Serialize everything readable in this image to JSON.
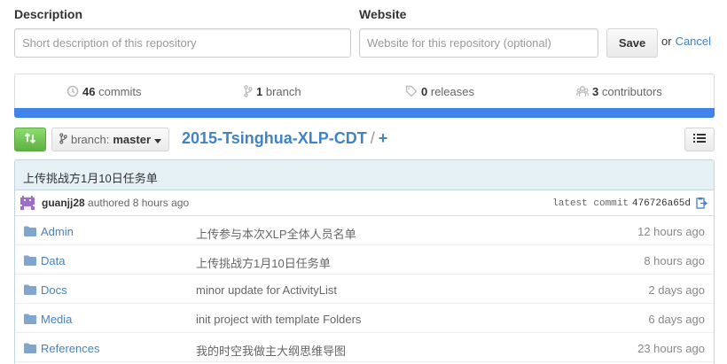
{
  "form": {
    "description_label": "Description",
    "description_placeholder": "Short description of this repository",
    "website_label": "Website",
    "website_placeholder": "Website for this repository (optional)",
    "save_label": "Save",
    "or_text": "or",
    "cancel_label": "Cancel"
  },
  "summary": {
    "commits_count": "46",
    "commits_label": "commits",
    "branch_count": "1",
    "branch_label": "branch",
    "releases_count": "0",
    "releases_label": "releases",
    "contributors_count": "3",
    "contributors_label": "contributors"
  },
  "language_bar": {
    "color": "#4183e8",
    "fraction": 1.0
  },
  "toolbar": {
    "branch_prefix": "branch:",
    "branch_name": "master",
    "repo_name": "2015-Tsinghua-XLP-CDT",
    "separator": "/",
    "plus": "+"
  },
  "commit": {
    "message": "上传挑战方1月10日任务单",
    "author": "guanjj28",
    "authored_text": "authored 8 hours ago",
    "latest_label": "latest commit",
    "sha": "476726a65d"
  },
  "files": [
    {
      "name": "Admin",
      "message": "上传参与本次XLP全体人员名单",
      "age": "12 hours ago"
    },
    {
      "name": "Data",
      "message": "上传挑战方1月10日任务单",
      "age": "8 hours ago"
    },
    {
      "name": "Docs",
      "message": "minor update for ActivityList",
      "age": "2 days ago"
    },
    {
      "name": "Media",
      "message": "init project with template Folders",
      "age": "6 days ago"
    },
    {
      "name": "References",
      "message": "我的时空我做主大纲思维导图",
      "age": "23 hours ago"
    }
  ],
  "icons": {
    "commits": "history-icon",
    "branch": "branch-icon",
    "releases": "tag-icon",
    "contributors": "organization-icon",
    "compare": "compare-icon",
    "list": "list-icon",
    "folder": "folder-icon",
    "clipboard": "clipboard-icon"
  },
  "colors": {
    "link": "#4183c4",
    "compare_green": "#60b044",
    "commit_bg": "#e6f1f6"
  }
}
